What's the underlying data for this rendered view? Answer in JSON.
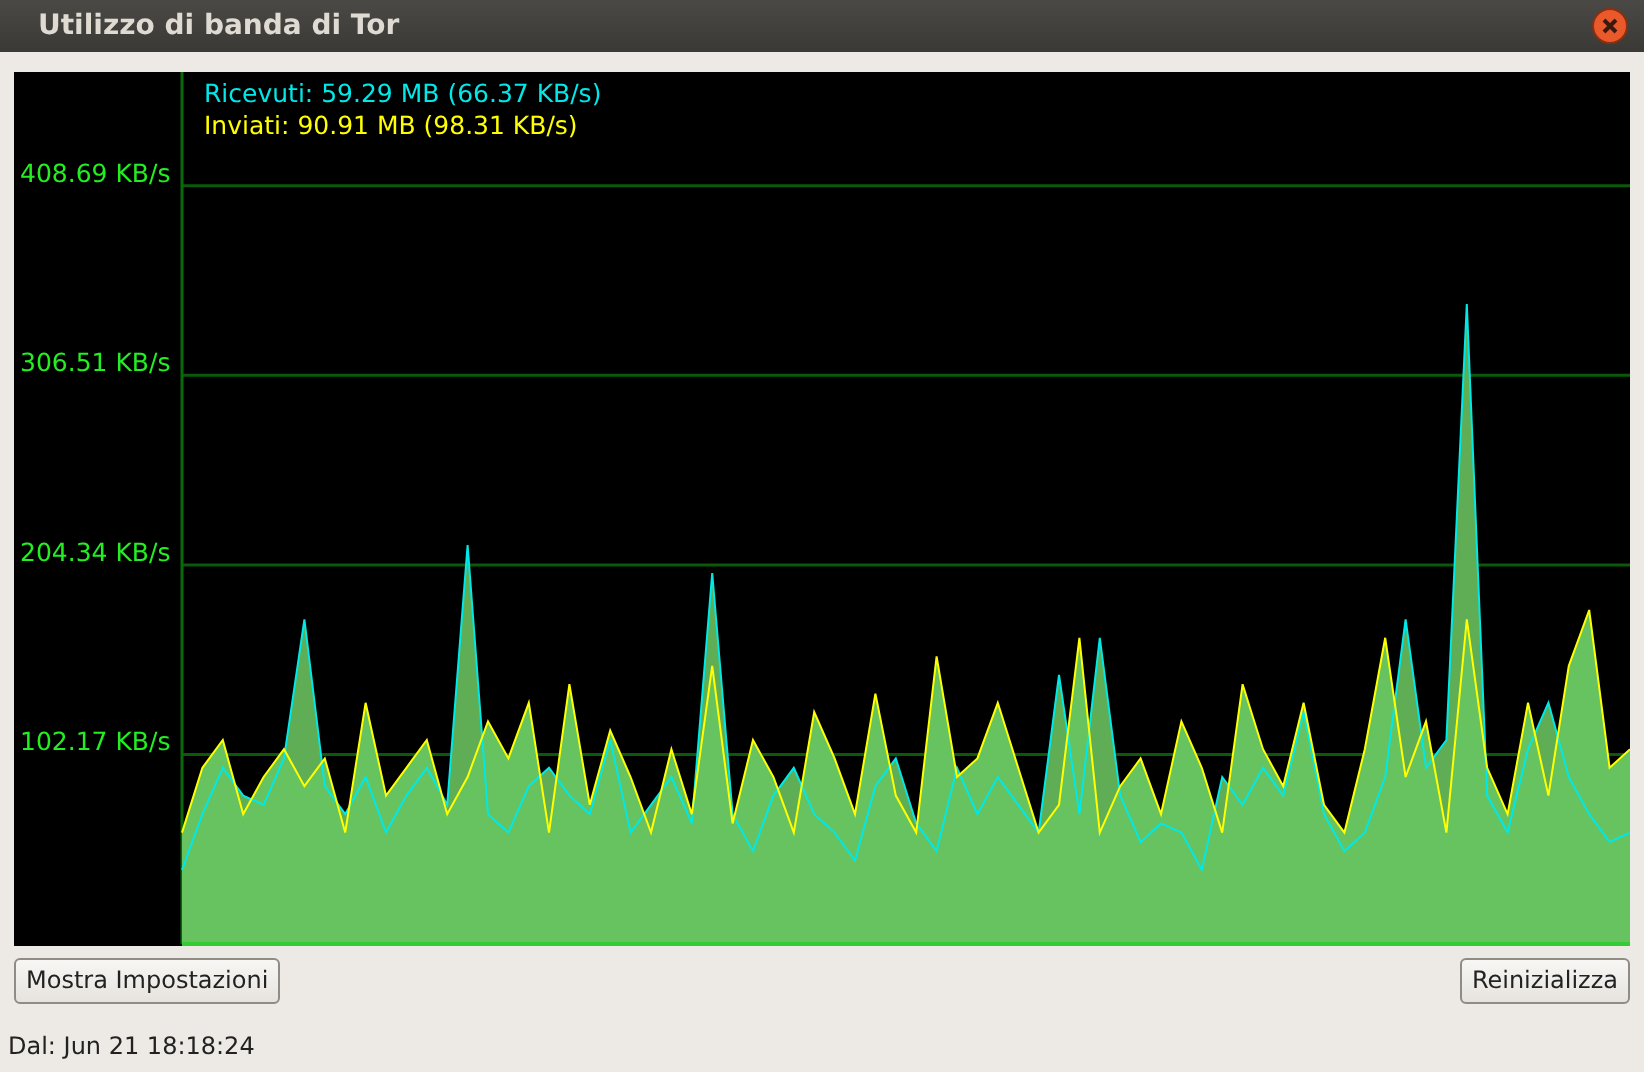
{
  "window": {
    "title": "Utilizzo di banda di Tor"
  },
  "graph": {
    "chart_data": {
      "type": "area",
      "grid": true,
      "ylim": [
        0,
        470
      ],
      "yticks": [
        {
          "value": 102.17,
          "label": "102.17 KB/s"
        },
        {
          "value": 204.34,
          "label": "204.34 KB/s"
        },
        {
          "value": 306.51,
          "label": "306.51 KB/s"
        },
        {
          "value": 408.69,
          "label": "408.69 KB/s"
        }
      ],
      "series": [
        {
          "name": "Ricevuti: 59.29 MB (66.37 KB/s)",
          "color": "#00e8e8",
          "values": [
            40,
            70,
            95,
            80,
            75,
            100,
            175,
            85,
            70,
            90,
            60,
            80,
            95,
            75,
            215,
            70,
            60,
            85,
            95,
            80,
            70,
            110,
            60,
            75,
            90,
            65,
            200,
            70,
            50,
            80,
            95,
            70,
            60,
            45,
            85,
            100,
            65,
            50,
            95,
            70,
            90,
            75,
            60,
            145,
            70,
            165,
            80,
            55,
            65,
            60,
            40,
            90,
            75,
            95,
            80,
            125,
            70,
            50,
            60,
            90,
            175,
            95,
            110,
            345,
            80,
            60,
            105,
            130,
            90,
            70,
            55,
            60
          ]
        },
        {
          "name": "Inviati: 90.91 MB (98.31 KB/s)",
          "color": "#ffff00",
          "values": [
            60,
            95,
            110,
            70,
            90,
            105,
            85,
            100,
            60,
            130,
            80,
            95,
            110,
            70,
            90,
            120,
            100,
            130,
            60,
            140,
            75,
            115,
            90,
            60,
            105,
            70,
            150,
            65,
            110,
            90,
            60,
            125,
            100,
            70,
            135,
            80,
            60,
            155,
            90,
            100,
            130,
            95,
            60,
            75,
            165,
            60,
            85,
            100,
            70,
            120,
            95,
            60,
            140,
            105,
            85,
            130,
            75,
            60,
            105,
            165,
            90,
            120,
            60,
            175,
            95,
            70,
            130,
            80,
            150,
            180,
            95,
            105
          ]
        }
      ]
    }
  },
  "buttons": [
    {
      "label": "Mostra Impostazioni"
    },
    {
      "label": "Reinizializza"
    }
  ],
  "status_bar": "Dal: Jun 21 18:18:24"
}
